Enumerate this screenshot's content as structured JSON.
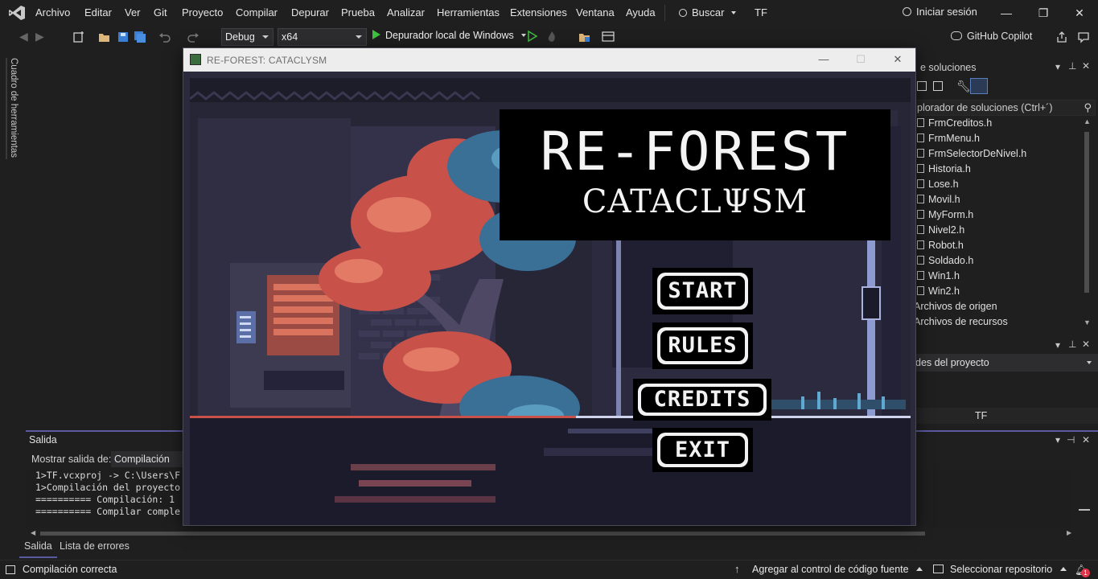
{
  "menubar": {
    "items": [
      "Archivo",
      "Editar",
      "Ver",
      "Git",
      "Proyecto",
      "Compilar",
      "Depurar",
      "Prueba",
      "Analizar",
      "Herramientas",
      "Extensiones",
      "Ventana",
      "Ayuda"
    ],
    "search_label": "Buscar",
    "solution_name": "TF",
    "signin_label": "Iniciar sesión"
  },
  "toolbar": {
    "configuration": "Debug",
    "platform": "x64",
    "debugger_label": "Depurador local de Windows",
    "copilot_label": "GitHub Copilot"
  },
  "toolbox": {
    "label": "Cuadro de herramientas"
  },
  "solution_explorer": {
    "title": "e soluciones",
    "search_placeholder": "plorador de soluciones (Ctrl+´)",
    "files": [
      "FrmCreditos.h",
      "FrmMenu.h",
      "FrmSelectorDeNivel.h",
      "Historia.h",
      "Lose.h",
      "Movil.h",
      "MyForm.h",
      "Nivel2.h",
      "Robot.h",
      "Soldado.h",
      "Win1.h",
      "Win2.h"
    ],
    "folders": [
      "Archivos de origen",
      "Archivos de recursos"
    ]
  },
  "properties": {
    "combo_text": "des del proyecto",
    "value": "TF"
  },
  "output": {
    "title": "Salida",
    "show_label": "Mostrar salida de:",
    "source": "Compilación",
    "lines": [
      "1>TF.vcxproj -> C:\\Users\\F",
      "1>Compilación del proyecto",
      "========== Compilación: 1",
      "========== Compilar comple"
    ]
  },
  "bottom_tabs": [
    "Salida",
    "Lista de errores"
  ],
  "statusbar": {
    "status": "Compilación correcta",
    "source_control": "Agregar al control de código fuente",
    "repo": "Seleccionar repositorio",
    "notifications": "1"
  },
  "game": {
    "window_title": "RE-FOREST: CATACLYSM",
    "title_main": "RE-FOREST",
    "title_sub": "CATACLΨSM",
    "buttons": [
      "START",
      "RULES",
      "CREDITS",
      "EXIT"
    ]
  },
  "colors": {
    "ide_bg": "#1f1f1f",
    "accent_output": "#5a5aa0",
    "play_green": "#3fbf3f",
    "tree_red": "#c8524a",
    "tree_blue": "#3a6f96",
    "scene_dark": "#262538"
  }
}
